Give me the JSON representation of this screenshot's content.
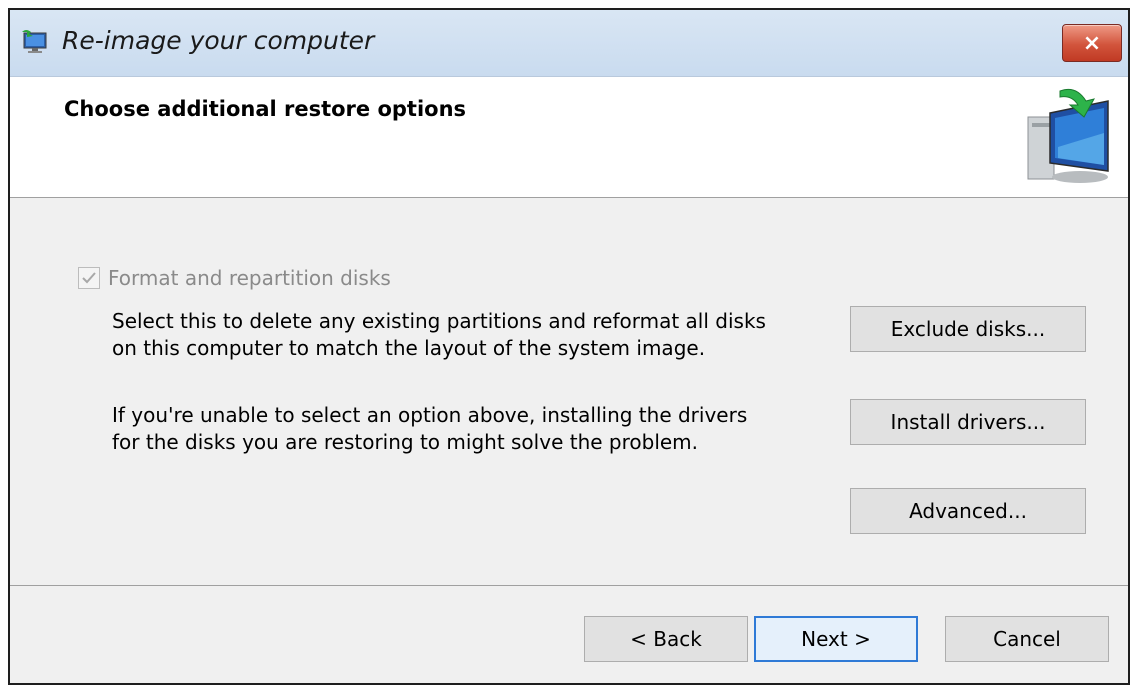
{
  "window": {
    "title": "Re-image your computer",
    "close_label": "×"
  },
  "header": {
    "heading": "Choose additional restore options"
  },
  "options": {
    "format_checkbox_label": "Format and repartition disks",
    "format_checked": true,
    "format_enabled": false,
    "format_description_line1": "Select this to delete any existing partitions and reformat all disks",
    "format_description_line2": "on this computer to match the layout of the system image.",
    "drivers_description_line1": "If you're unable to select an option above, installing the drivers",
    "drivers_description_line2": "for the disks you are restoring to might solve the problem."
  },
  "side_buttons": {
    "exclude_label": "Exclude disks...",
    "drivers_label": "Install drivers...",
    "advanced_label": "Advanced..."
  },
  "footer": {
    "back_label": "< Back",
    "next_label": "Next >",
    "cancel_label": "Cancel"
  },
  "icons": {
    "app": "monitor-restore-icon",
    "header": "computer-restore-icon",
    "checkbox": "checkmark-icon"
  },
  "colors": {
    "titlebar": "#c9dbef",
    "close_button": "#d2543c",
    "default_button_border": "#2f7ad6",
    "dialog_background": "#f0f0f0"
  }
}
